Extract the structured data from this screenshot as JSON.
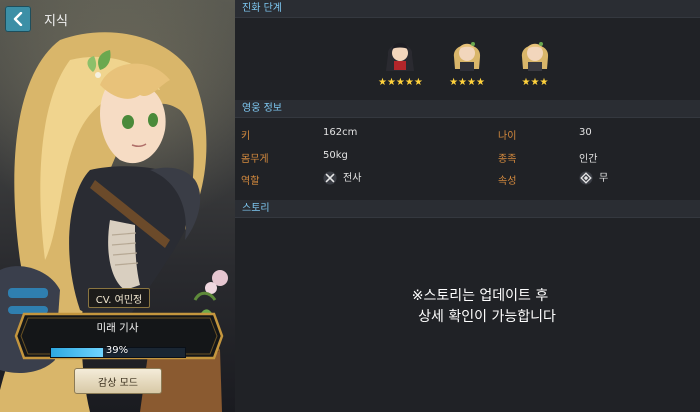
{
  "header": {
    "title": "지식"
  },
  "left_panel": {
    "cv_label": "CV. 여민정",
    "hero_title": "미래 기사",
    "progress_label": "39%",
    "progress_value": 0.39,
    "view_mode_label": "감상 모드"
  },
  "sections": {
    "evolution": "진화 단계",
    "hero_info": "영웅 정보",
    "story": "스토리"
  },
  "evolution": [
    {
      "stars": 5,
      "star_text": "★★★★★"
    },
    {
      "stars": 4,
      "star_text": "★★★★"
    },
    {
      "stars": 3,
      "star_text": "★★★"
    }
  ],
  "info": {
    "height_label": "키",
    "height_value": "162cm",
    "age_label": "나이",
    "age_value": "30",
    "weight_label": "몸무게",
    "weight_value": "50kg",
    "race_label": "종족",
    "race_value": "인간",
    "role_label": "역할",
    "role_value": "전사",
    "attribute_label": "속성",
    "attribute_value": "무"
  },
  "story_text": {
    "line1": "※스토리는 업데이트 후",
    "line2": "상세 확인이 가능합니다"
  },
  "colors": {
    "accent": "#7ec8f2",
    "label": "#d48a3e",
    "progress": "#2da8e0",
    "star": "#ffd23c"
  }
}
